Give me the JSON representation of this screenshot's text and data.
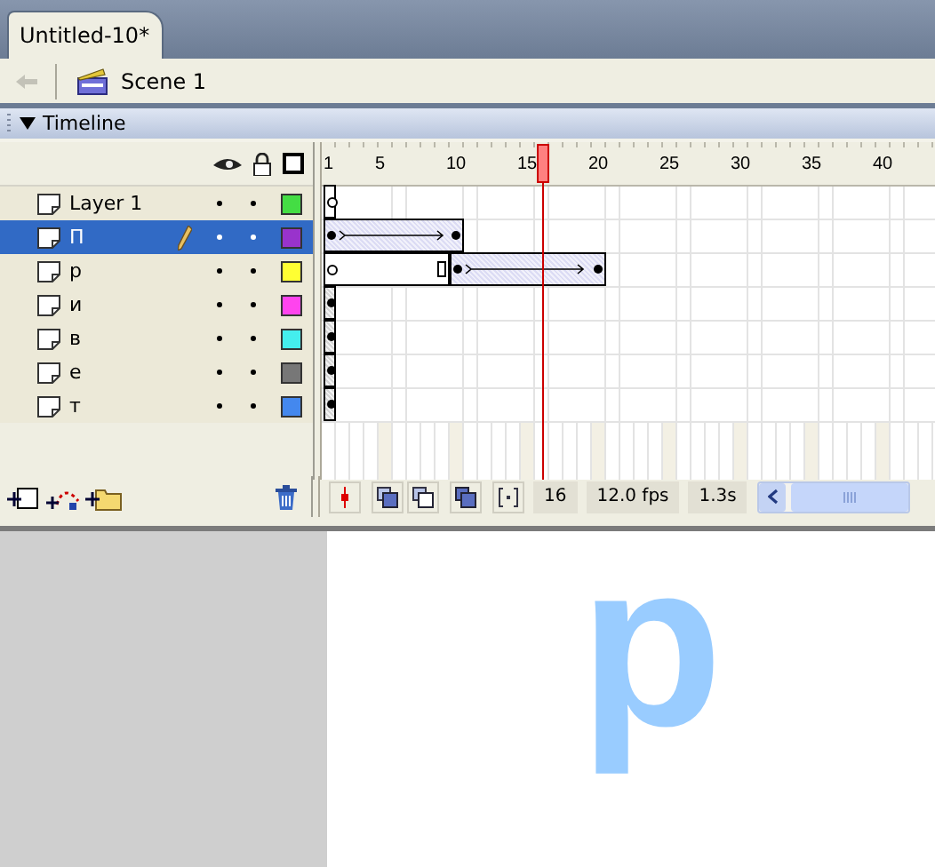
{
  "document_tab": {
    "title": "Untitled-10*",
    "selected": true
  },
  "edit_bar": {
    "scene": "Scene 1"
  },
  "timeline": {
    "title": "Timeline",
    "expanded": true,
    "ruler": [
      "1",
      "5",
      "10",
      "15",
      "20",
      "25",
      "30",
      "35",
      "40"
    ],
    "layers": [
      {
        "name": "Layer 1",
        "selected": false,
        "color": "#44dd44",
        "frames": [
          {
            "kind": "empty_keyframe"
          }
        ]
      },
      {
        "name": "П",
        "selected": true,
        "color": "#9933cc",
        "frames": [
          {
            "kind": "keyframe"
          },
          {
            "kind": "tween"
          },
          {
            "kind": "tween"
          },
          {
            "kind": "tween"
          },
          {
            "kind": "tween"
          },
          {
            "kind": "tween"
          },
          {
            "kind": "tween"
          },
          {
            "kind": "tween"
          },
          {
            "kind": "tween"
          },
          {
            "kind": "tween_end"
          }
        ]
      },
      {
        "name": "р",
        "selected": false,
        "color": "#ffff33",
        "frames": [
          {
            "kind": "empty_keyframe"
          },
          {
            "kind": "hold"
          },
          {
            "kind": "hold"
          },
          {
            "kind": "hold"
          },
          {
            "kind": "hold"
          },
          {
            "kind": "hold"
          },
          {
            "kind": "hold"
          },
          {
            "kind": "hold"
          },
          {
            "kind": "hold_end"
          },
          {
            "kind": "keyframe"
          },
          {
            "kind": "tween"
          },
          {
            "kind": "tween"
          },
          {
            "kind": "tween"
          },
          {
            "kind": "tween"
          },
          {
            "kind": "tween"
          },
          {
            "kind": "tween"
          },
          {
            "kind": "tween"
          },
          {
            "kind": "tween"
          },
          {
            "kind": "tween"
          },
          {
            "kind": "tween_end"
          }
        ]
      },
      {
        "name": "и",
        "selected": false,
        "color": "#ff44ee",
        "frames": [
          {
            "kind": "keyframe"
          }
        ]
      },
      {
        "name": "в",
        "selected": false,
        "color": "#44eeee",
        "frames": [
          {
            "kind": "keyframe"
          }
        ]
      },
      {
        "name": "е",
        "selected": false,
        "color": "#777777",
        "frames": [
          {
            "kind": "keyframe"
          }
        ]
      },
      {
        "name": "т",
        "selected": false,
        "color": "#4488ee",
        "frames": [
          {
            "kind": "keyframe"
          }
        ]
      }
    ],
    "status": {
      "frame": "16",
      "rate": "12.0 fps",
      "time": "1.3s"
    }
  },
  "stage": {
    "glyph": "р",
    "color": "#99ccff"
  }
}
